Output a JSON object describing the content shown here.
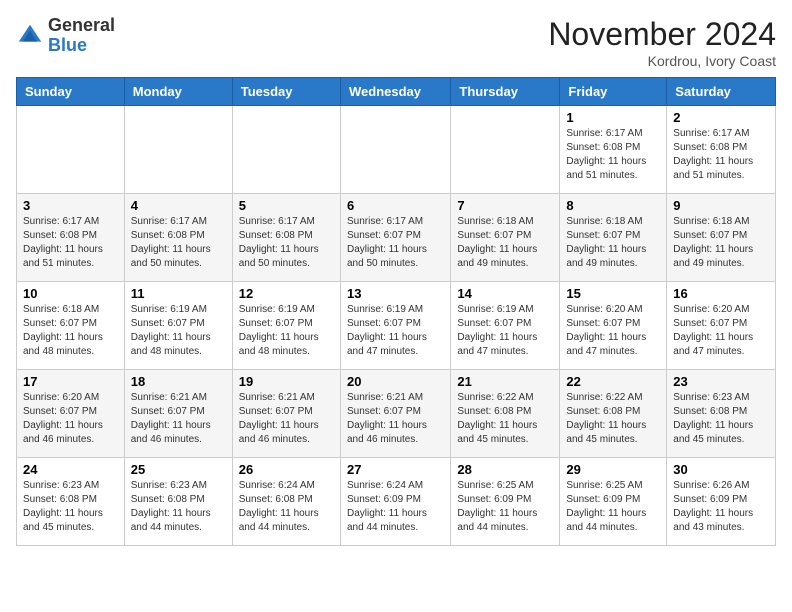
{
  "header": {
    "logo_general": "General",
    "logo_blue": "Blue",
    "month_title": "November 2024",
    "location": "Kordrou, Ivory Coast"
  },
  "days_of_week": [
    "Sunday",
    "Monday",
    "Tuesday",
    "Wednesday",
    "Thursday",
    "Friday",
    "Saturday"
  ],
  "weeks": [
    [
      {
        "day": "",
        "info": ""
      },
      {
        "day": "",
        "info": ""
      },
      {
        "day": "",
        "info": ""
      },
      {
        "day": "",
        "info": ""
      },
      {
        "day": "",
        "info": ""
      },
      {
        "day": "1",
        "info": "Sunrise: 6:17 AM\nSunset: 6:08 PM\nDaylight: 11 hours and 51 minutes."
      },
      {
        "day": "2",
        "info": "Sunrise: 6:17 AM\nSunset: 6:08 PM\nDaylight: 11 hours and 51 minutes."
      }
    ],
    [
      {
        "day": "3",
        "info": "Sunrise: 6:17 AM\nSunset: 6:08 PM\nDaylight: 11 hours and 51 minutes."
      },
      {
        "day": "4",
        "info": "Sunrise: 6:17 AM\nSunset: 6:08 PM\nDaylight: 11 hours and 50 minutes."
      },
      {
        "day": "5",
        "info": "Sunrise: 6:17 AM\nSunset: 6:08 PM\nDaylight: 11 hours and 50 minutes."
      },
      {
        "day": "6",
        "info": "Sunrise: 6:17 AM\nSunset: 6:07 PM\nDaylight: 11 hours and 50 minutes."
      },
      {
        "day": "7",
        "info": "Sunrise: 6:18 AM\nSunset: 6:07 PM\nDaylight: 11 hours and 49 minutes."
      },
      {
        "day": "8",
        "info": "Sunrise: 6:18 AM\nSunset: 6:07 PM\nDaylight: 11 hours and 49 minutes."
      },
      {
        "day": "9",
        "info": "Sunrise: 6:18 AM\nSunset: 6:07 PM\nDaylight: 11 hours and 49 minutes."
      }
    ],
    [
      {
        "day": "10",
        "info": "Sunrise: 6:18 AM\nSunset: 6:07 PM\nDaylight: 11 hours and 48 minutes."
      },
      {
        "day": "11",
        "info": "Sunrise: 6:19 AM\nSunset: 6:07 PM\nDaylight: 11 hours and 48 minutes."
      },
      {
        "day": "12",
        "info": "Sunrise: 6:19 AM\nSunset: 6:07 PM\nDaylight: 11 hours and 48 minutes."
      },
      {
        "day": "13",
        "info": "Sunrise: 6:19 AM\nSunset: 6:07 PM\nDaylight: 11 hours and 47 minutes."
      },
      {
        "day": "14",
        "info": "Sunrise: 6:19 AM\nSunset: 6:07 PM\nDaylight: 11 hours and 47 minutes."
      },
      {
        "day": "15",
        "info": "Sunrise: 6:20 AM\nSunset: 6:07 PM\nDaylight: 11 hours and 47 minutes."
      },
      {
        "day": "16",
        "info": "Sunrise: 6:20 AM\nSunset: 6:07 PM\nDaylight: 11 hours and 47 minutes."
      }
    ],
    [
      {
        "day": "17",
        "info": "Sunrise: 6:20 AM\nSunset: 6:07 PM\nDaylight: 11 hours and 46 minutes."
      },
      {
        "day": "18",
        "info": "Sunrise: 6:21 AM\nSunset: 6:07 PM\nDaylight: 11 hours and 46 minutes."
      },
      {
        "day": "19",
        "info": "Sunrise: 6:21 AM\nSunset: 6:07 PM\nDaylight: 11 hours and 46 minutes."
      },
      {
        "day": "20",
        "info": "Sunrise: 6:21 AM\nSunset: 6:07 PM\nDaylight: 11 hours and 46 minutes."
      },
      {
        "day": "21",
        "info": "Sunrise: 6:22 AM\nSunset: 6:08 PM\nDaylight: 11 hours and 45 minutes."
      },
      {
        "day": "22",
        "info": "Sunrise: 6:22 AM\nSunset: 6:08 PM\nDaylight: 11 hours and 45 minutes."
      },
      {
        "day": "23",
        "info": "Sunrise: 6:23 AM\nSunset: 6:08 PM\nDaylight: 11 hours and 45 minutes."
      }
    ],
    [
      {
        "day": "24",
        "info": "Sunrise: 6:23 AM\nSunset: 6:08 PM\nDaylight: 11 hours and 45 minutes."
      },
      {
        "day": "25",
        "info": "Sunrise: 6:23 AM\nSunset: 6:08 PM\nDaylight: 11 hours and 44 minutes."
      },
      {
        "day": "26",
        "info": "Sunrise: 6:24 AM\nSunset: 6:08 PM\nDaylight: 11 hours and 44 minutes."
      },
      {
        "day": "27",
        "info": "Sunrise: 6:24 AM\nSunset: 6:09 PM\nDaylight: 11 hours and 44 minutes."
      },
      {
        "day": "28",
        "info": "Sunrise: 6:25 AM\nSunset: 6:09 PM\nDaylight: 11 hours and 44 minutes."
      },
      {
        "day": "29",
        "info": "Sunrise: 6:25 AM\nSunset: 6:09 PM\nDaylight: 11 hours and 44 minutes."
      },
      {
        "day": "30",
        "info": "Sunrise: 6:26 AM\nSunset: 6:09 PM\nDaylight: 11 hours and 43 minutes."
      }
    ]
  ]
}
